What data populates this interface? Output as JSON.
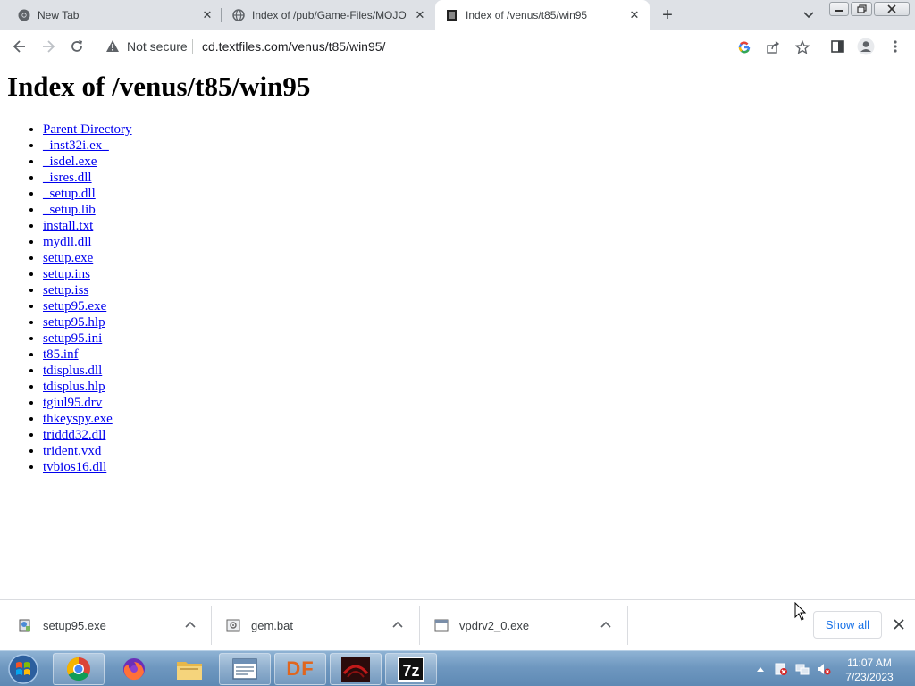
{
  "browser": {
    "tabs": [
      {
        "title": "New Tab",
        "icon": "chrome-icon",
        "active": false
      },
      {
        "title": "Index of /pub/Game-Files/MOJO",
        "icon": "globe-icon",
        "active": false
      },
      {
        "title": "Index of /venus/t85/win95",
        "icon": "textfiles-icon",
        "active": true
      }
    ],
    "security_label": "Not secure",
    "url": "cd.textfiles.com/venus/t85/win95/"
  },
  "page": {
    "heading": "Index of /venus/t85/win95",
    "links": [
      "Parent Directory",
      "_inst32i.ex_",
      "_isdel.exe",
      "_isres.dll",
      "_setup.dll",
      "_setup.lib",
      "install.txt",
      "mydll.dll",
      "setup.exe",
      "setup.ins",
      "setup.iss",
      "setup95.exe",
      "setup95.hlp",
      "setup95.ini",
      "t85.inf",
      "tdisplus.dll",
      "tdisplus.hlp",
      "tgiul95.drv",
      "thkeyspy.exe",
      "triddd32.dll",
      "trident.vxd",
      "tvbios16.dll"
    ]
  },
  "downloads": {
    "items": [
      {
        "name": "setup95.exe",
        "icon": "installer-icon"
      },
      {
        "name": "gem.bat",
        "icon": "batch-file-icon"
      },
      {
        "name": "vpdrv2_0.exe",
        "icon": "exe-icon"
      }
    ],
    "show_all_label": "Show all"
  },
  "taskbar": {
    "apps": [
      {
        "name": "chrome",
        "icon": "chrome-icon",
        "label": ""
      },
      {
        "name": "firefox",
        "icon": "firefox-icon",
        "label": ""
      },
      {
        "name": "file-explorer",
        "icon": "folder-icon",
        "label": ""
      },
      {
        "name": "window-app",
        "icon": "window-icon",
        "label": ""
      },
      {
        "name": "df-app",
        "icon": "df-icon",
        "label": "DF"
      },
      {
        "name": "game-app",
        "icon": "game-icon",
        "label": ""
      },
      {
        "name": "7zip",
        "icon": "7zip-icon",
        "label": "7z"
      }
    ],
    "time": "11:07 AM",
    "date": "7/23/2023"
  },
  "colors": {
    "link": "#0000ee",
    "tabstrip": "#dee1e6",
    "accent": "#1a73e8"
  }
}
